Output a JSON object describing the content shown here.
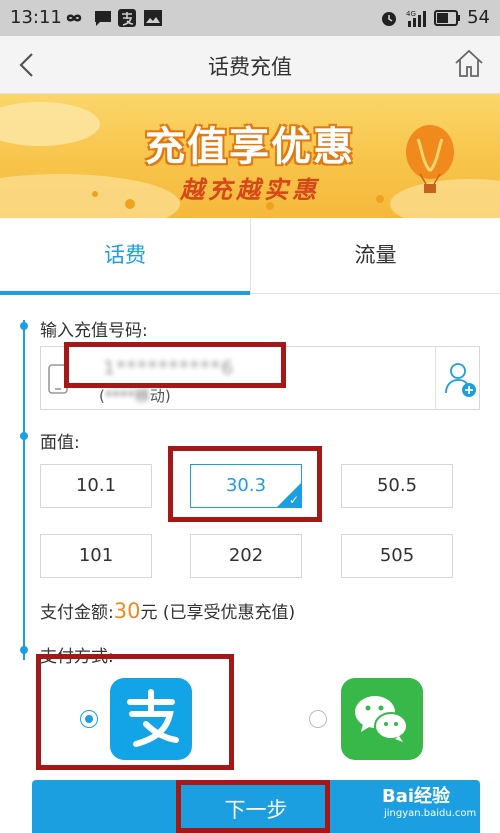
{
  "status_bar": {
    "time": "13:11",
    "battery_level": "54",
    "icons": [
      "infinity-icon",
      "message-icon",
      "alipay-notification-icon",
      "image-icon",
      "alarm-icon",
      "4g-signal-icon",
      "signal-icon",
      "battery-icon"
    ]
  },
  "nav": {
    "title": "话费充值",
    "back_icon": "chevron-left-icon",
    "home_icon": "home-icon"
  },
  "banner": {
    "title": "充值享优惠",
    "subtitle": "越充越实惠",
    "colors": {
      "background": "#f7c44a",
      "title_stroke": "#e07a12",
      "subtitle": "#d6471a"
    }
  },
  "tabs": [
    {
      "label": "话费",
      "active": true
    },
    {
      "label": "流量",
      "active": false
    }
  ],
  "recharge_number": {
    "label": "输入充值号码:",
    "value": "1**********6",
    "carrier_prefix": "(",
    "carrier_blurred": "****移",
    "carrier_suffix": "动)"
  },
  "denomination": {
    "label": "面值:",
    "options": [
      "10.1",
      "30.3",
      "50.5",
      "101",
      "202",
      "505"
    ],
    "selected": "30.3"
  },
  "payment_amount": {
    "label": "支付金额:",
    "amount": "30",
    "unit": "元",
    "note": "(已享受优惠充值)"
  },
  "payment_method": {
    "label": "支付方式:",
    "options": [
      {
        "name": "alipay",
        "icon": "alipay-icon",
        "selected": true
      },
      {
        "name": "wechat-pay",
        "icon": "wechat-icon",
        "selected": false
      }
    ]
  },
  "next_button": {
    "label": "下一步"
  },
  "watermark": {
    "main": "Bai经验",
    "sub": "jingyan.baidu.com"
  },
  "colors": {
    "accent": "#1b9fe0",
    "amount": "#f08a1d",
    "annotation": "#a51818",
    "alipay": "#13a4e8",
    "wechat": "#38b849"
  }
}
